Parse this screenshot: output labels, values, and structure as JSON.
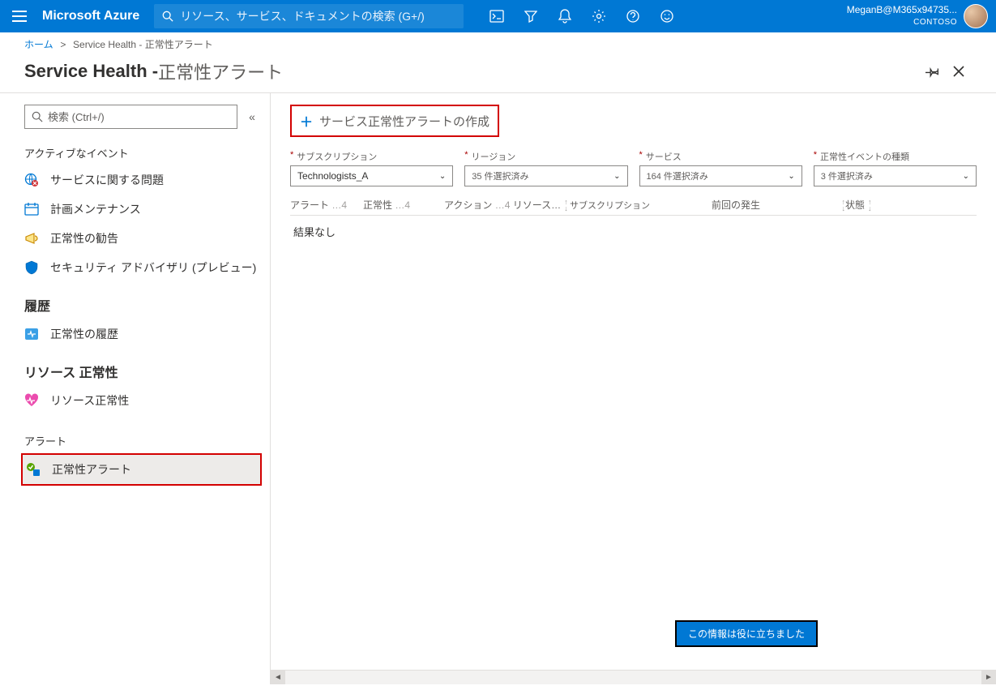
{
  "topbar": {
    "brand": "Microsoft Azure",
    "search_placeholder": "リソース、サービス、ドキュメントの検索 (G+/)",
    "user": "MeganB@M365x94735...",
    "org": "CONTOSO"
  },
  "breadcrumb": {
    "home": "ホーム",
    "service": "Service Health",
    "page": "正常性アラート"
  },
  "heading": {
    "main": "Service Health - ",
    "sub": "正常性アラート"
  },
  "sidebar": {
    "search_placeholder": "検索 (Ctrl+/)",
    "group_active": "アクティブなイベント",
    "items_active": [
      {
        "label": "サービスに関する問題"
      },
      {
        "label": "計画メンテナンス"
      },
      {
        "label": "正常性の勧告"
      },
      {
        "label": "セキュリティ アドバイザリ (プレビュー)"
      }
    ],
    "group_history": "履歴",
    "items_history": [
      {
        "label": "正常性の履歴"
      }
    ],
    "group_resource": "リソース 正常性",
    "items_resource": [
      {
        "label": "リソース正常性"
      }
    ],
    "group_alert": "アラート",
    "items_alert": [
      {
        "label": "正常性アラート"
      }
    ]
  },
  "main": {
    "create_label": "サービス正常性アラートの作成",
    "filters": [
      {
        "label": "サブスクリプション",
        "value": "Technologists_A"
      },
      {
        "label": "リージョン",
        "value": "35 件選択済み"
      },
      {
        "label": "サービス",
        "value": "164 件選択済み"
      },
      {
        "label": "正常性イベントの種類",
        "value": "3 件選択済み"
      }
    ],
    "columns": {
      "c1a": "アラート",
      "c1b": "…4",
      "c2a": "正常性",
      "c2b": "…4",
      "c3a": "アクション",
      "c3b": "…4",
      "c3c": "リソース…",
      "c4": "サブスクリプション",
      "c5": "前回の発生",
      "c6": "状態"
    },
    "no_results": "結果なし",
    "feedback": "この情報は役に立ちました"
  }
}
